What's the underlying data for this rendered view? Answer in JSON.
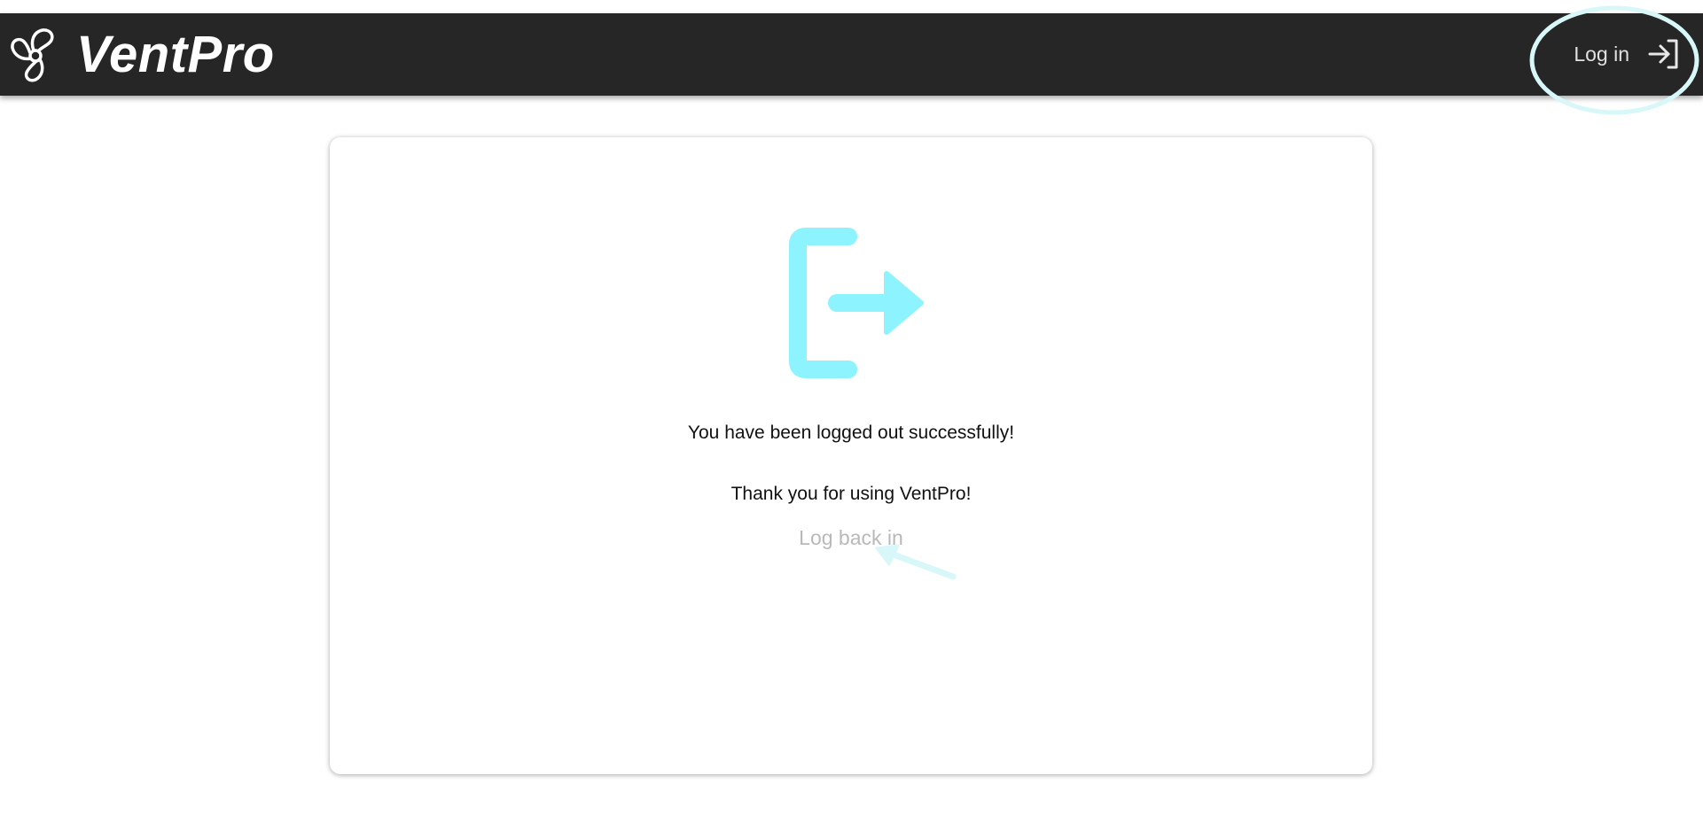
{
  "header": {
    "brand_name": "VentPro",
    "brand_icon": "fan-icon",
    "login_label": "Log in",
    "login_icon": "login-arrow-icon"
  },
  "main": {
    "icon": "logout-icon",
    "message": "You have been logged out successfully!",
    "thanks": "Thank you for using VentPro!",
    "relogin_link": "Log back in"
  },
  "colors": {
    "topbar": "#262626",
    "accent": "#8cf3ff",
    "link": "#b9b9b9",
    "annotation": "#d8f7f9"
  }
}
